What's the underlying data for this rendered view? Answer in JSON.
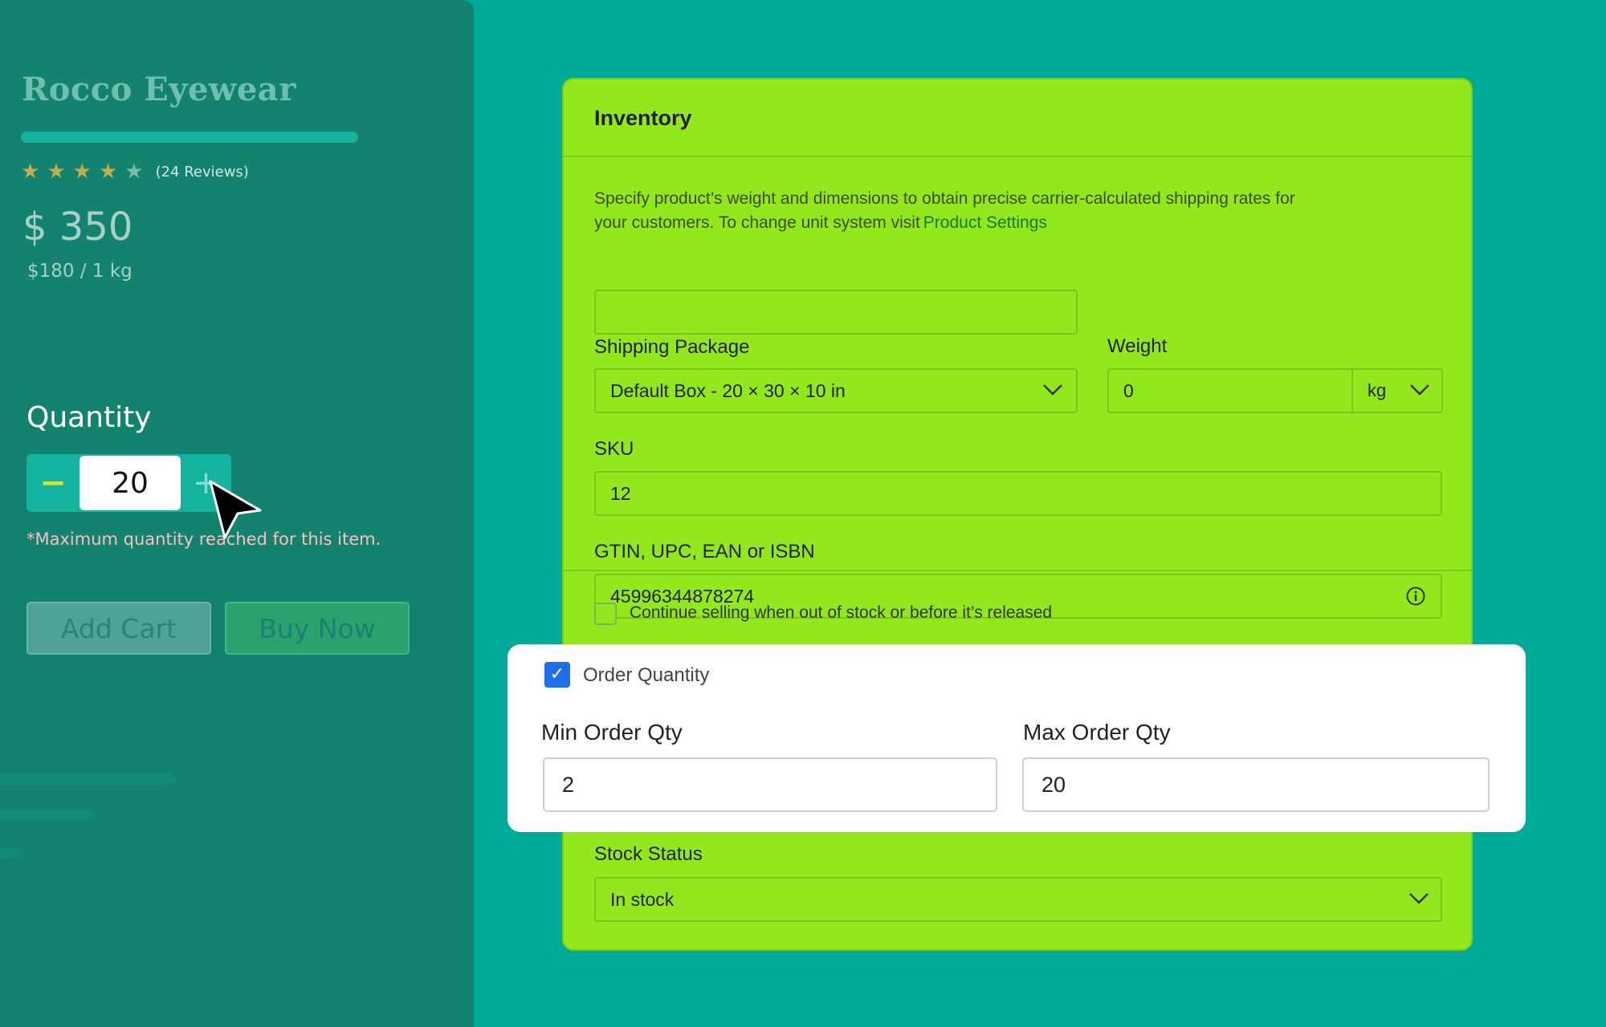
{
  "product": {
    "brand": "Rocco Eyewear",
    "stars": [
      "★",
      "★",
      "★",
      "★",
      "★"
    ],
    "rating_filled": 4,
    "rating_max": 5,
    "reviews": "(24 Reviews)",
    "price": "$ 350",
    "unit_price": "$180 / 1 kg",
    "quantity_label": "Quantity",
    "quantity_value": "20",
    "minus_symbol": "−",
    "plus_symbol": "+",
    "max_message": "*Maximum quantity reached for this item.",
    "add_cart_label": "Add Cart",
    "buy_now_label": "Buy Now"
  },
  "inventory": {
    "title": "Inventory",
    "description": "Specify product’s weight and dimensions to obtain precise carrier-calculated shipping rates for your customers. To change unit system visit",
    "description_link": "Product Settings",
    "shipping_package_label": "Shipping Package",
    "shipping_package_value": "Default Box - 20 × 30 × 10 in",
    "weight_label": "Weight",
    "weight_value": "0",
    "weight_unit": "kg",
    "sku_label": "SKU",
    "sku_value": "12",
    "gtin_label": "GTIN, UPC, EAN or ISBN",
    "gtin_value": "45996344878274",
    "continue_selling_label": "Continue selling when out of stock or before it’s released",
    "stock_status_label": "Stock Status",
    "stock_status_value": "In stock"
  },
  "order_quantity": {
    "checkbox_label": "Order Quantity",
    "checkbox_mark": "✓",
    "min_label": "Min Order Qty",
    "min_value": "2",
    "max_label": "Max Order Qty",
    "max_value": "20"
  },
  "icons": {
    "chevron": "chevron-down-icon",
    "info": "info-icon",
    "cursor": "mouse-pointer-icon",
    "star": "star-icon",
    "check": "check-icon"
  },
  "colors": {
    "background": "#00aa99",
    "left_panel": "#13836f",
    "card": "#92e81c",
    "checkbox_checked": "#1f6fe8",
    "link": "#0f7a30"
  }
}
